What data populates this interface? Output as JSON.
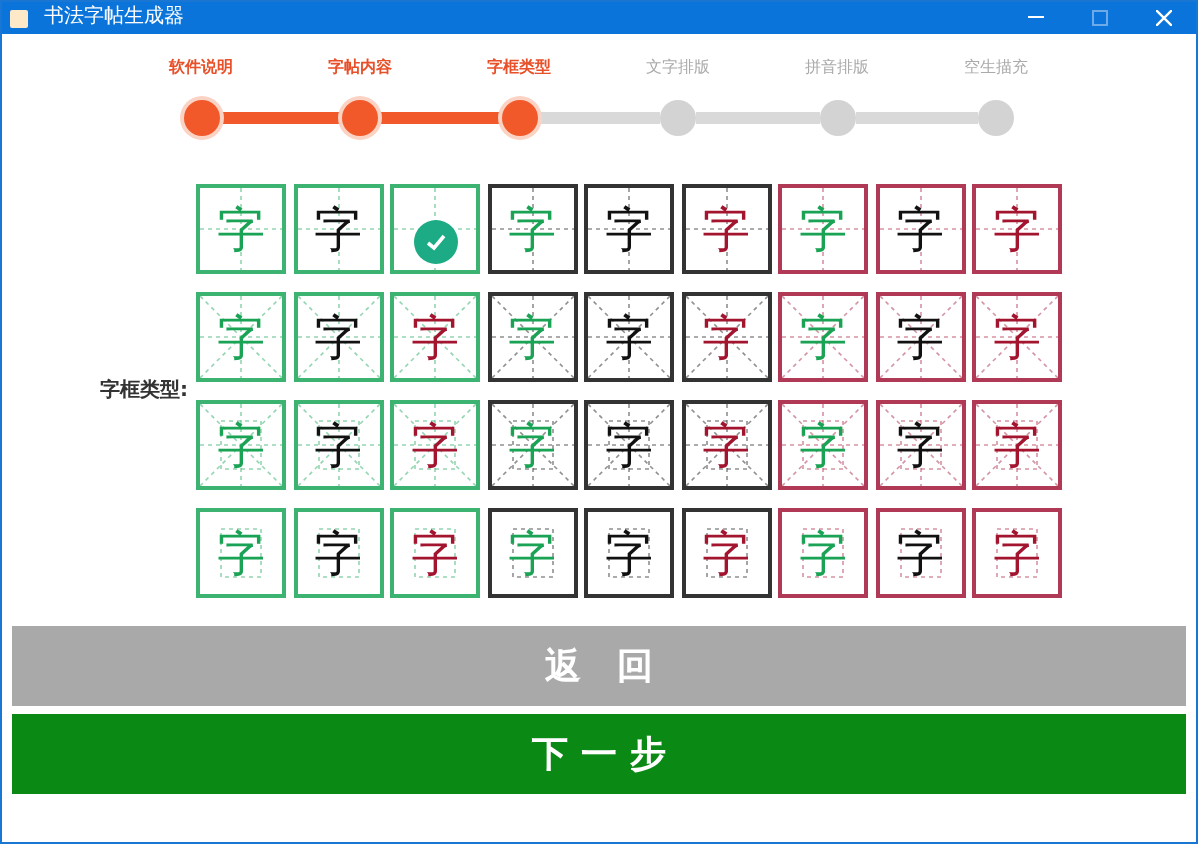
{
  "window": {
    "title": "书法字帖生成器"
  },
  "steps": [
    {
      "label": "软件说明",
      "done": true
    },
    {
      "label": "字帖内容",
      "done": true
    },
    {
      "label": "字框类型",
      "done": true
    },
    {
      "label": "文字排版",
      "done": false
    },
    {
      "label": "拼音排版",
      "done": false
    },
    {
      "label": "空生描充",
      "done": false
    }
  ],
  "frame_type": {
    "label": "字框类型:",
    "rows": [
      {
        "kind": "tian",
        "cells": [
          {
            "glyph": {
              "text": "字",
              "color": "#1aa355"
            },
            "frame": {
              "color": "#3cb371"
            },
            "selected": false
          },
          {
            "glyph": {
              "text": "字",
              "color": "#111111"
            },
            "frame": {
              "color": "#3cb371"
            },
            "selected": false
          },
          {
            "frame": {
              "color": "#3cb371"
            },
            "selected": true
          },
          {
            "glyph": {
              "text": "字",
              "color": "#1aa355"
            },
            "frame": {
              "color": "#333333"
            },
            "selected": false
          },
          {
            "glyph": {
              "text": "字",
              "color": "#111111"
            },
            "frame": {
              "color": "#333333"
            },
            "selected": false
          },
          {
            "glyph": {
              "text": "字",
              "color": "#a3142f"
            },
            "frame": {
              "color": "#333333"
            },
            "selected": false
          },
          {
            "glyph": {
              "text": "字",
              "color": "#1aa355"
            },
            "frame": {
              "color": "#b03a55"
            },
            "selected": false
          },
          {
            "glyph": {
              "text": "字",
              "color": "#111111"
            },
            "frame": {
              "color": "#b03a55"
            },
            "selected": false
          },
          {
            "glyph": {
              "text": "字",
              "color": "#a3142f"
            },
            "frame": {
              "color": "#b03a55"
            },
            "selected": false
          }
        ]
      },
      {
        "kind": "mi",
        "cells": [
          {
            "glyph": {
              "text": "字",
              "color": "#1aa355"
            },
            "frame": {
              "color": "#3cb371"
            },
            "selected": false
          },
          {
            "glyph": {
              "text": "字",
              "color": "#111111"
            },
            "frame": {
              "color": "#3cb371"
            },
            "selected": false
          },
          {
            "glyph": {
              "text": "字",
              "color": "#a3142f"
            },
            "frame": {
              "color": "#3cb371"
            },
            "selected": false
          },
          {
            "glyph": {
              "text": "字",
              "color": "#1aa355"
            },
            "frame": {
              "color": "#333333"
            },
            "selected": false
          },
          {
            "glyph": {
              "text": "字",
              "color": "#111111"
            },
            "frame": {
              "color": "#333333"
            },
            "selected": false
          },
          {
            "glyph": {
              "text": "字",
              "color": "#a3142f"
            },
            "frame": {
              "color": "#333333"
            },
            "selected": false
          },
          {
            "glyph": {
              "text": "字",
              "color": "#1aa355"
            },
            "frame": {
              "color": "#b03a55"
            },
            "selected": false
          },
          {
            "glyph": {
              "text": "字",
              "color": "#111111"
            },
            "frame": {
              "color": "#b03a55"
            },
            "selected": false
          },
          {
            "glyph": {
              "text": "字",
              "color": "#a3142f"
            },
            "frame": {
              "color": "#b03a55"
            },
            "selected": false
          }
        ]
      },
      {
        "kind": "mi_box",
        "cells": [
          {
            "glyph": {
              "text": "字",
              "color": "#1aa355"
            },
            "frame": {
              "color": "#3cb371"
            },
            "selected": false
          },
          {
            "glyph": {
              "text": "字",
              "color": "#111111"
            },
            "frame": {
              "color": "#3cb371"
            },
            "selected": false
          },
          {
            "glyph": {
              "text": "字",
              "color": "#a3142f"
            },
            "frame": {
              "color": "#3cb371"
            },
            "selected": false
          },
          {
            "glyph": {
              "text": "字",
              "color": "#1aa355"
            },
            "frame": {
              "color": "#333333"
            },
            "selected": false
          },
          {
            "glyph": {
              "text": "字",
              "color": "#111111"
            },
            "frame": {
              "color": "#333333"
            },
            "selected": false
          },
          {
            "glyph": {
              "text": "字",
              "color": "#a3142f"
            },
            "frame": {
              "color": "#333333"
            },
            "selected": false
          },
          {
            "glyph": {
              "text": "字",
              "color": "#1aa355"
            },
            "frame": {
              "color": "#b03a55"
            },
            "selected": false
          },
          {
            "glyph": {
              "text": "字",
              "color": "#111111"
            },
            "frame": {
              "color": "#b03a55"
            },
            "selected": false
          },
          {
            "glyph": {
              "text": "字",
              "color": "#a3142f"
            },
            "frame": {
              "color": "#b03a55"
            },
            "selected": false
          }
        ]
      },
      {
        "kind": "box",
        "cells": [
          {
            "glyph": {
              "text": "字",
              "color": "#1aa355"
            },
            "frame": {
              "color": "#3cb371"
            },
            "selected": false
          },
          {
            "glyph": {
              "text": "字",
              "color": "#111111"
            },
            "frame": {
              "color": "#3cb371"
            },
            "selected": false
          },
          {
            "glyph": {
              "text": "字",
              "color": "#a3142f"
            },
            "frame": {
              "color": "#3cb371"
            },
            "selected": false
          },
          {
            "glyph": {
              "text": "字",
              "color": "#1aa355"
            },
            "frame": {
              "color": "#333333"
            },
            "selected": false
          },
          {
            "glyph": {
              "text": "字",
              "color": "#111111"
            },
            "frame": {
              "color": "#333333"
            },
            "selected": false
          },
          {
            "glyph": {
              "text": "字",
              "color": "#a3142f"
            },
            "frame": {
              "color": "#333333"
            },
            "selected": false
          },
          {
            "glyph": {
              "text": "字",
              "color": "#1aa355"
            },
            "frame": {
              "color": "#b03a55"
            },
            "selected": false
          },
          {
            "glyph": {
              "text": "字",
              "color": "#111111"
            },
            "frame": {
              "color": "#b03a55"
            },
            "selected": false
          },
          {
            "glyph": {
              "text": "字",
              "color": "#a3142f"
            },
            "frame": {
              "color": "#b03a55"
            },
            "selected": false
          }
        ]
      }
    ]
  },
  "buttons": [
    {
      "label": "返　回",
      "kind": "secondary"
    },
    {
      "label": "下 一 步",
      "kind": "primary"
    }
  ]
}
